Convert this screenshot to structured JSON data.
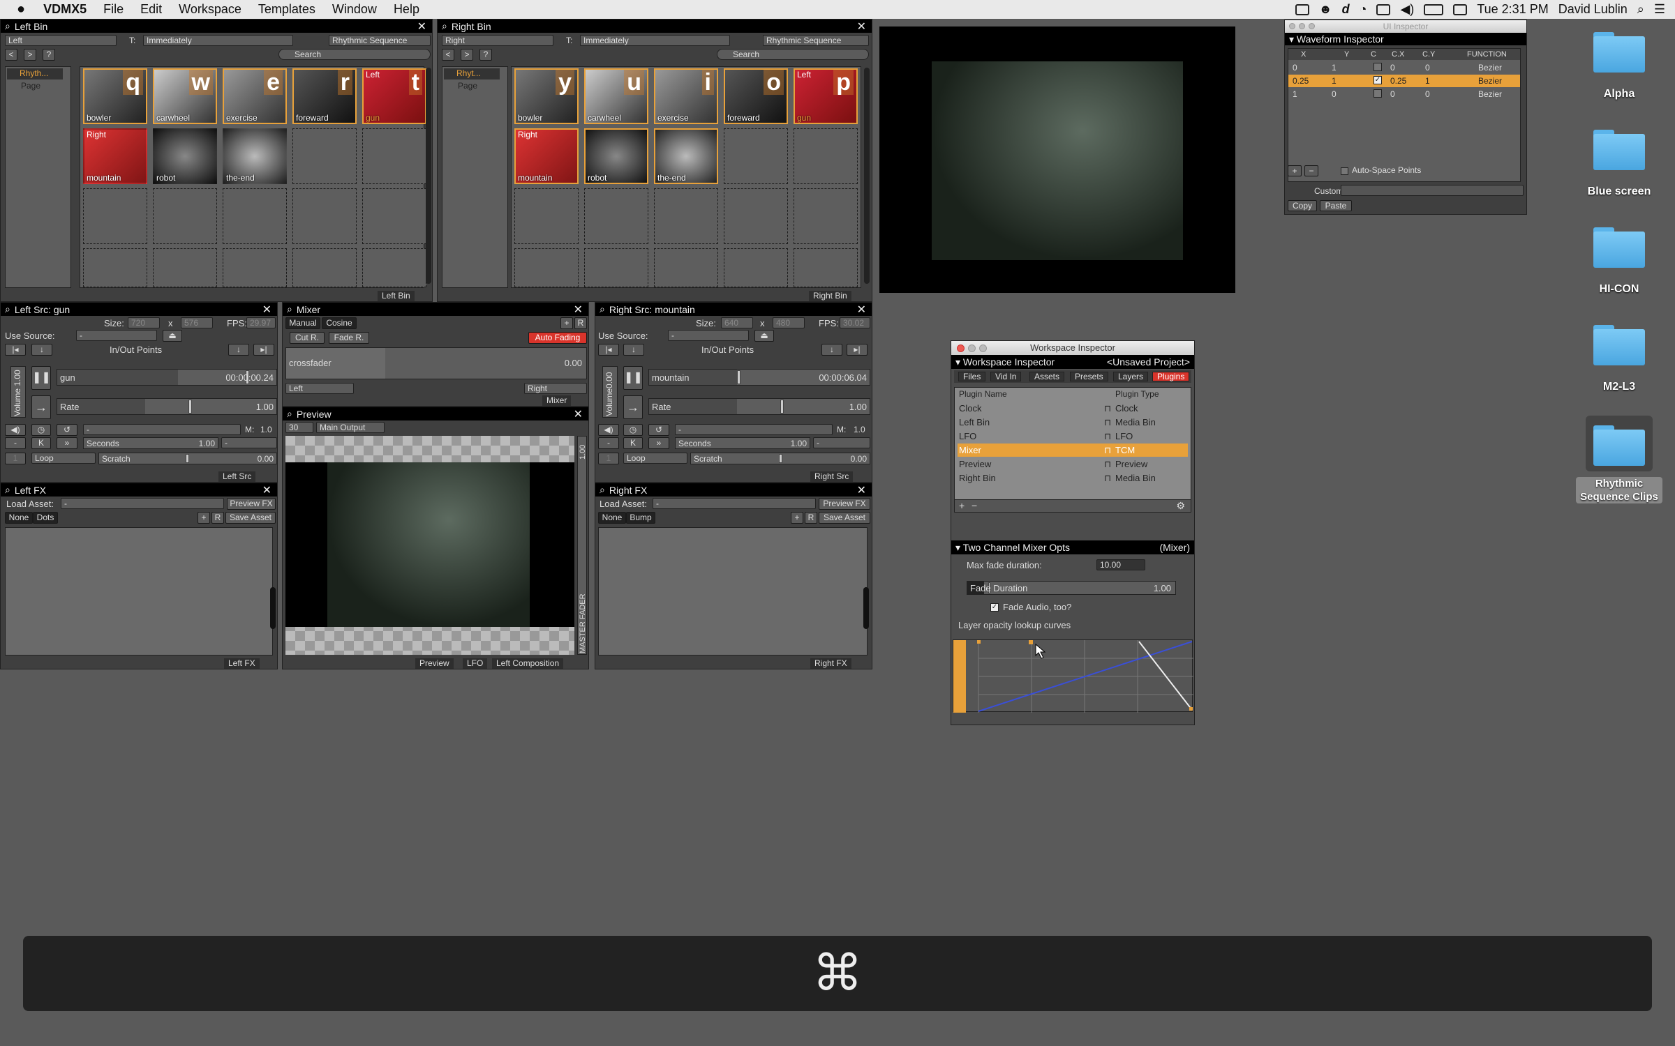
{
  "menubar": {
    "apple": "",
    "app": "VDMX5",
    "items": [
      "File",
      "Edit",
      "Workspace",
      "Templates",
      "Window",
      "Help"
    ],
    "clock": "Tue 2:31 PM",
    "user": "David Lublin"
  },
  "left_bin": {
    "title": "Left Bin",
    "layer": "Left",
    "trigger_label": "T:",
    "trigger": "Immediately",
    "mode": "Rhythmic Sequence",
    "search": "Search",
    "list": [
      "Rhyth...",
      "Page"
    ],
    "clips": [
      {
        "key": "q",
        "name": "bowler",
        "side": ""
      },
      {
        "key": "w",
        "name": "carwheel",
        "side": ""
      },
      {
        "key": "e",
        "name": "exercise",
        "side": ""
      },
      {
        "key": "r",
        "name": "foreward",
        "side": ""
      },
      {
        "key": "t",
        "name": "gun",
        "side": "Left"
      },
      {
        "key": "",
        "name": "mountain",
        "side": "Right"
      },
      {
        "key": "",
        "name": "robot",
        "side": ""
      },
      {
        "key": "",
        "name": "the-end",
        "side": ""
      }
    ],
    "footer": "Left Bin"
  },
  "right_bin": {
    "title": "Right Bin",
    "layer": "Right",
    "trigger_label": "T:",
    "trigger": "Immediately",
    "mode": "Rhythmic Sequence",
    "search": "Search",
    "list": [
      "Rhyt...",
      "Page"
    ],
    "clips": [
      {
        "key": "y",
        "name": "bowler",
        "side": ""
      },
      {
        "key": "u",
        "name": "carwheel",
        "side": ""
      },
      {
        "key": "i",
        "name": "exercise",
        "side": ""
      },
      {
        "key": "o",
        "name": "foreward",
        "side": ""
      },
      {
        "key": "p",
        "name": "gun",
        "side": "Left"
      },
      {
        "key": "",
        "name": "mountain",
        "side": "Right"
      },
      {
        "key": "",
        "name": "robot",
        "side": ""
      },
      {
        "key": "",
        "name": "the-end",
        "side": ""
      }
    ],
    "footer": "Right Bin"
  },
  "left_src": {
    "title": "Left Src: gun",
    "size_label": "Size:",
    "w": "720",
    "x": "x",
    "h": "576",
    "fps_label": "FPS:",
    "fps": "29.97",
    "use_source": "Use Source:",
    "source": "-",
    "inout": "In/Out Points",
    "clip": "gun",
    "time": "00:00:00.24",
    "rate": "Rate",
    "rate_val": "1.00",
    "seconds": "Seconds",
    "seconds_val": "1.00",
    "m_label": "M:",
    "m_val": "1.0",
    "loop": "Loop",
    "scratch": "Scratch",
    "scratch_val": "0.00",
    "volume": "Volume 1.00",
    "footer": "Left Src"
  },
  "right_src": {
    "title": "Right Src: mountain",
    "size_label": "Size:",
    "w": "640",
    "x": "x",
    "h": "480",
    "fps_label": "FPS:",
    "fps": "30.02",
    "use_source": "Use Source:",
    "source": "-",
    "inout": "In/Out Points",
    "clip": "mountain",
    "time": "00:00:06.04",
    "rate": "Rate",
    "rate_val": "1.00",
    "seconds": "Seconds",
    "seconds_val": "1.00",
    "m_label": "M:",
    "m_val": "1.0",
    "loop": "Loop",
    "scratch": "Scratch",
    "scratch_val": "0.00",
    "volume": "Volume0.00",
    "footer": "Right Src"
  },
  "mixer": {
    "title": "Mixer",
    "manual": "Manual",
    "cosine": "Cosine",
    "plus": "+",
    "r": "R",
    "cut": "Cut R.",
    "fade": "Fade R.",
    "auto": "Auto Fading",
    "crossfader": "crossfader",
    "cf_val": "0.00",
    "left": "Left",
    "right": "Right",
    "footer": "Mixer"
  },
  "preview": {
    "title": "Preview",
    "fps": "30",
    "output": "Main Output",
    "master": "MASTER FADER",
    "master_val": "1.00",
    "footers": [
      "Preview",
      "LFO",
      "Left Composition"
    ]
  },
  "left_fx": {
    "title": "Left FX",
    "load": "Load Asset:",
    "asset": "-",
    "preview": "Preview FX",
    "none": "None",
    "dots": "Dots",
    "plus": "+",
    "r": "R",
    "save": "Save Asset",
    "footer": "Left FX"
  },
  "right_fx": {
    "title": "Right FX",
    "load": "Load Asset:",
    "asset": "-",
    "preview": "Preview FX",
    "none": "None",
    "bump": "Bump",
    "plus": "+",
    "r": "R",
    "save": "Save Asset",
    "footer": "Right FX"
  },
  "ui_inspector": {
    "title": "UI Inspector",
    "section": "Waveform Inspector",
    "cols": [
      "X",
      "Y",
      "C",
      "C.X",
      "C.Y",
      "FUNCTION"
    ],
    "rows": [
      [
        "0",
        "1",
        "",
        "0",
        "0",
        "Bezier"
      ],
      [
        "0.25",
        "1",
        "✓",
        "0.25",
        "1",
        "Bezier"
      ],
      [
        "1",
        "0",
        "",
        "0",
        "0",
        "Bezier"
      ]
    ],
    "auto_space": "Auto-Space Points",
    "custom": "Custom:",
    "copy": "Copy",
    "paste": "Paste"
  },
  "workspace": {
    "title": "Workspace Inspector",
    "header": "Workspace Inspector",
    "project": "<Unsaved Project>",
    "tabs": [
      "Files",
      "Vid In",
      "Assets",
      "Presets",
      "Layers",
      "Plugins"
    ],
    "col_name": "Plugin Name",
    "col_type": "Plugin Type",
    "plugins": [
      [
        "Clock",
        "Clock"
      ],
      [
        "Left Bin",
        "Media Bin"
      ],
      [
        "LFO",
        "LFO"
      ],
      [
        "Mixer",
        "TCM"
      ],
      [
        "Preview",
        "Preview"
      ],
      [
        "Right Bin",
        "Media Bin"
      ]
    ],
    "opts_title": "Two Channel Mixer Opts",
    "opts_tag": "(Mixer)",
    "max_fade": "Max fade duration:",
    "max_fade_val": "10.00",
    "fade_duration": "Fade Duration",
    "fade_val": "1.00",
    "fade_audio": "Fade Audio, too?",
    "curves": "Layer opacity lookup curves"
  },
  "desktop": {
    "folders": [
      "Alpha",
      "Blue screen",
      "HI-CON",
      "M2-L3",
      "Rhythmic Sequence Clips"
    ]
  },
  "dock": {
    "symbol": "⌘"
  },
  "colors": {
    "accent": "#e8a13a",
    "red": "#d9342b",
    "folder": "#5bb4ea"
  }
}
